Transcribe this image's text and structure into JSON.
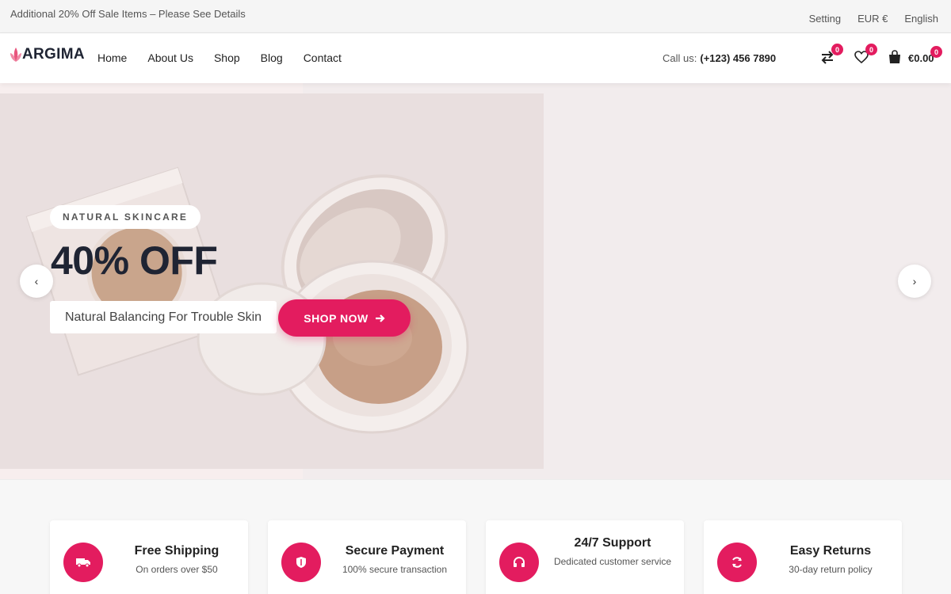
{
  "topbar": {
    "promo": "Additional 20% Off Sale Items – Please See Details",
    "setting": "Setting",
    "currency": "EUR €",
    "language": "English"
  },
  "header": {
    "logo": "ARGIMA",
    "nav": [
      "Home",
      "About Us",
      "Shop",
      "Blog",
      "Contact"
    ],
    "call_label": "Call us:",
    "phone": "(+123) 456 7890",
    "compare_count": "0",
    "wishlist_count": "0",
    "cart_count": "0",
    "cart_total": "€0.00"
  },
  "hero": {
    "tag": "NATURAL SKINCARE",
    "title": "40% OFF",
    "subtitle": "Natural Balancing For Trouble Skin",
    "cta": "SHOP NOW",
    "prev": "‹",
    "next": "›"
  },
  "features": [
    {
      "icon": "truck-icon",
      "title": "Free Shipping",
      "desc": "On orders over $50"
    },
    {
      "icon": "shield-icon",
      "title": "Secure Payment",
      "desc": "100% secure transaction"
    },
    {
      "icon": "headset-icon",
      "title": "24/7 Support",
      "desc": "Dedicated customer service"
    },
    {
      "icon": "refresh-icon",
      "title": "Easy Returns",
      "desc": "30-day return policy"
    }
  ],
  "colors": {
    "accent": "#e31c5f",
    "dark": "#1f2433",
    "hero_bg": "#e9dfdf"
  }
}
